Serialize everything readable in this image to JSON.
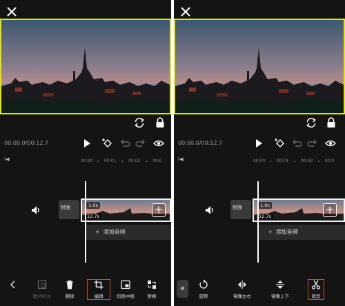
{
  "icons": {
    "close": "close-icon",
    "rotate": "sync-icon",
    "lock": "lock-icon",
    "play": "play-icon",
    "keyframe": "keyframe-add-icon",
    "undo": "undo-icon",
    "redo": "redo-icon",
    "eye": "eye-icon",
    "speaker": "speaker-icon"
  },
  "colors": {
    "accent": "#e8451e",
    "preview_border": "#e6e600",
    "background": "#141414"
  },
  "left": {
    "timecode": "00:00.0/00:12.7",
    "ruler_edge": "I◀",
    "ruler_ticks": [
      "00:00",
      "00:01",
      "00:02",
      "00:0"
    ],
    "cover_label": "封面",
    "clip_speed": "1.0x",
    "clip_duration": "12.7s",
    "add_audio": "添加音频",
    "tools": [
      {
        "label": "",
        "icon": "back-icon"
      },
      {
        "label": "图片时长",
        "icon": "image-duration-icon"
      },
      {
        "label": "删除",
        "icon": "trash-icon"
      },
      {
        "label": "编辑",
        "icon": "crop-icon"
      },
      {
        "label": "切画中画",
        "icon": "pip-icon"
      },
      {
        "label": "替换",
        "icon": "replace-icon"
      }
    ]
  },
  "right": {
    "timecode": "00:00.0/00:12.7",
    "ruler_edge": "I◀",
    "ruler_ticks": [
      "00:00",
      "00:01",
      "00:02",
      "00:0"
    ],
    "cover_label": "封面",
    "clip_speed": "1.0x",
    "clip_duration": "12.7s",
    "add_audio": "添加音频",
    "back_label": "«",
    "tools": [
      {
        "label": "旋转",
        "icon": "rotate-icon"
      },
      {
        "label": "镜像左右",
        "icon": "mirror-horizontal-icon"
      },
      {
        "label": "镜像上下",
        "icon": "mirror-vertical-icon"
      },
      {
        "label": "裁剪",
        "icon": "scissors-icon"
      }
    ]
  }
}
